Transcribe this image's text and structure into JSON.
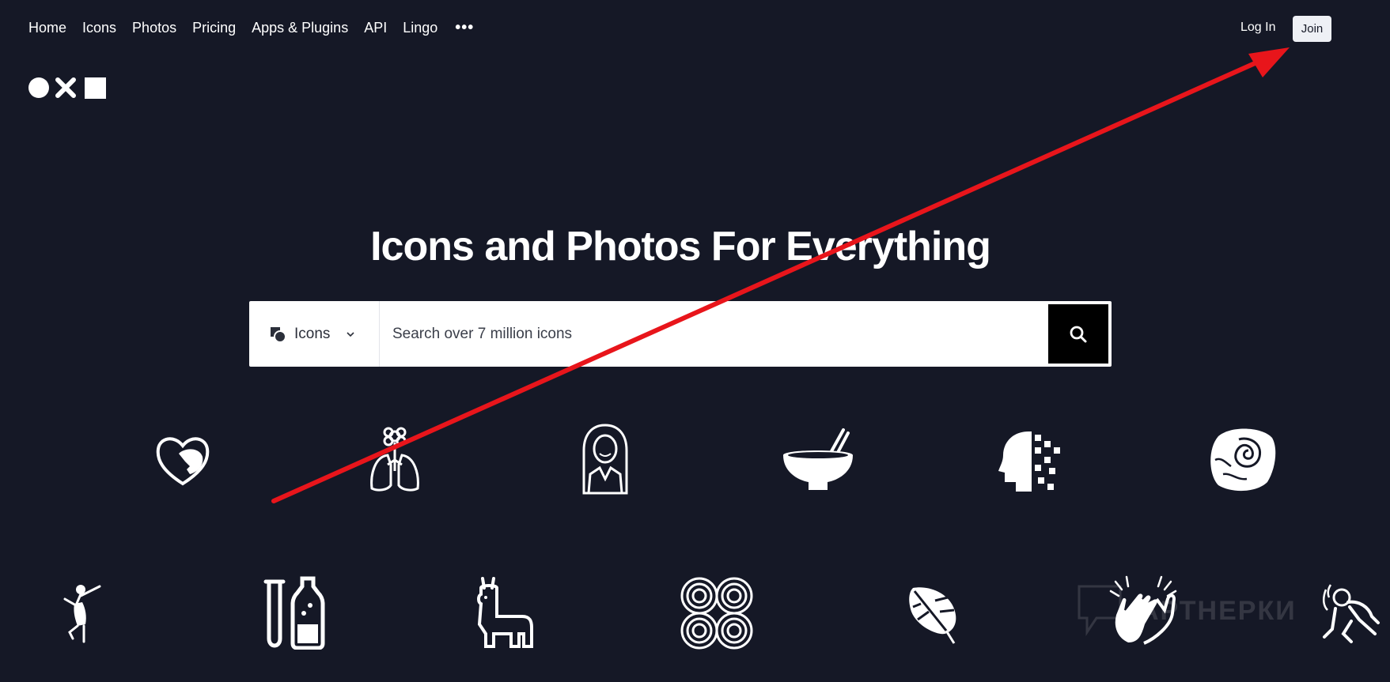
{
  "nav": {
    "items": [
      {
        "label": "Home"
      },
      {
        "label": "Icons"
      },
      {
        "label": "Photos"
      },
      {
        "label": "Pricing"
      },
      {
        "label": "Apps & Plugins"
      },
      {
        "label": "API"
      },
      {
        "label": "Lingo"
      }
    ],
    "more_label": "•••"
  },
  "auth": {
    "login": "Log In",
    "join": "Join"
  },
  "hero": {
    "title": "Icons and Photos For Everything"
  },
  "search": {
    "type_label": "Icons",
    "placeholder": "Search over 7 million icons"
  },
  "icons_row1": [
    "heart-face-icon",
    "lungs-flower-icon",
    "woman-portrait-icon",
    "bowl-chopsticks-icon",
    "head-pixel-icon",
    "fossil-stone-icon"
  ],
  "icons_row2": [
    "dancer-icon",
    "test-tube-bottle-icon",
    "llama-icon",
    "spiral-pattern-icon",
    "monstera-leaf-icon",
    "clapping-hands-icon",
    "wrestler-icon"
  ],
  "watermark": {
    "text": "АРТНЕРКИ"
  },
  "annotation": {
    "color": "#e8151b"
  }
}
